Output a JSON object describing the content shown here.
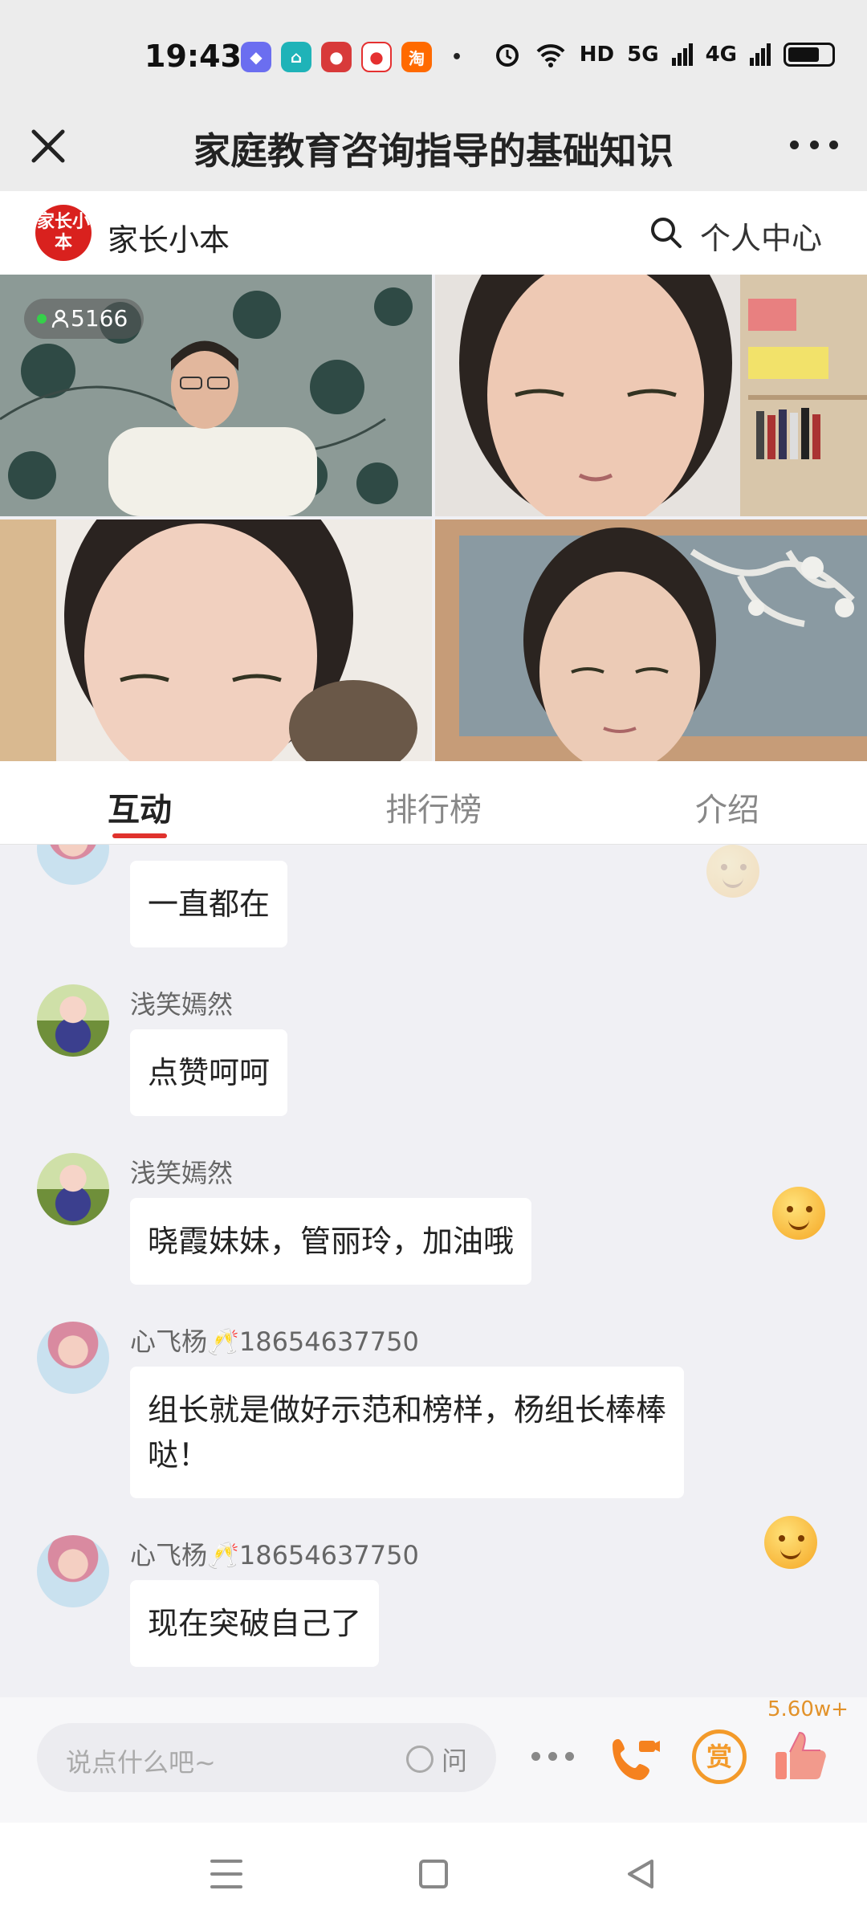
{
  "status_bar": {
    "time": "19:43",
    "network_labels": [
      "HD",
      "5G",
      "4G"
    ]
  },
  "title_bar": {
    "title": "家庭教育咨询指导的基础知识"
  },
  "brand_bar": {
    "logo_text": "家长小本",
    "brand_name": "家长小本",
    "personal_center": "个人中心"
  },
  "video": {
    "viewer_count": "5166"
  },
  "tabs": [
    {
      "label": "互动",
      "active": true
    },
    {
      "label": "排行榜",
      "active": false
    },
    {
      "label": "介绍",
      "active": false
    }
  ],
  "chat": {
    "messages": [
      {
        "sender": "",
        "text": "一直都在"
      },
      {
        "sender": "浅笑嫣然",
        "text": "点赞呵呵"
      },
      {
        "sender": "浅笑嫣然",
        "text": "晓霞妹妹，管丽玲，加油哦"
      },
      {
        "sender": "心飞杨🥂18654637750",
        "text": "组长就是做好示范和榜样，杨组长棒棒哒！"
      },
      {
        "sender": "心飞杨🥂18654637750",
        "text": "现在突破自己了"
      }
    ]
  },
  "input_bar": {
    "placeholder": "说点什么吧~",
    "ask_label": "问",
    "reward_label": "赏",
    "like_count": "5.60w+"
  },
  "colors": {
    "accent_red": "#e0322d",
    "reward_orange": "#f39a2a",
    "chat_bg": "#f0f0f4"
  },
  "icons": [
    "close-icon",
    "more-icon",
    "search-icon",
    "people-icon",
    "phone-icon",
    "like-icon",
    "menu-icon",
    "home-icon",
    "back-icon"
  ]
}
